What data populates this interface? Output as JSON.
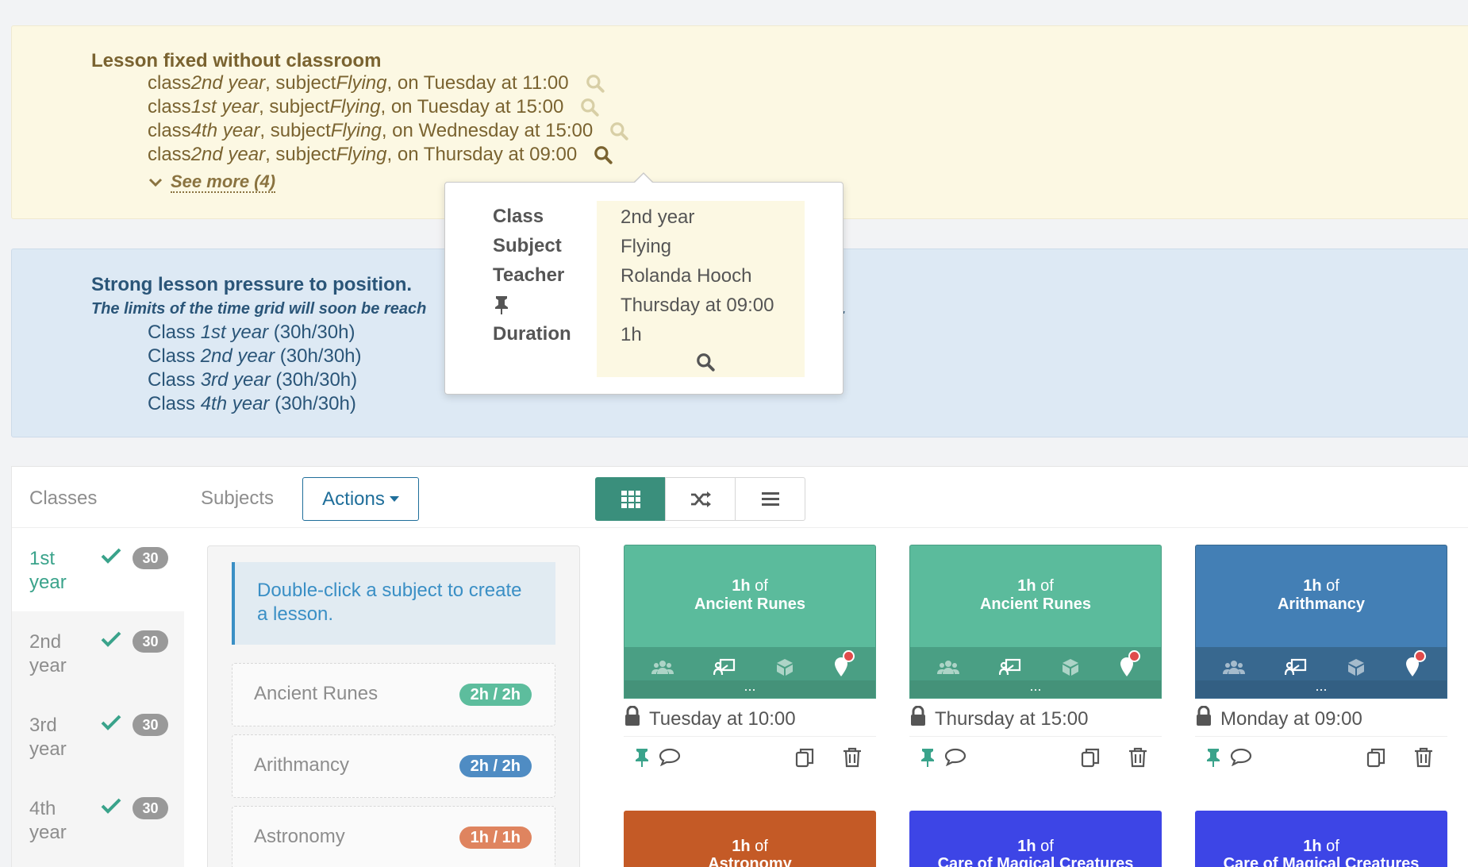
{
  "warning": {
    "title": "Lesson fixed without classroom",
    "lines": [
      {
        "pre": "class ",
        "cls": "2nd year",
        "mid": ", subject ",
        "subj": "Flying",
        "post": ", on Tuesday at 11:00"
      },
      {
        "pre": "class ",
        "cls": "1st year",
        "mid": ", subject ",
        "subj": "Flying",
        "post": ", on Tuesday at 15:00"
      },
      {
        "pre": "class ",
        "cls": "4th year",
        "mid": ", subject ",
        "subj": "Flying",
        "post": ", on Wednesday at 15:00"
      },
      {
        "pre": "class ",
        "cls": "2nd year",
        "mid": ", subject ",
        "subj": "Flying",
        "post": ", on Thursday at 09:00"
      }
    ],
    "see_more": "See more (4)"
  },
  "info": {
    "title": "Strong lesson pressure to position.",
    "subtitle_left": "The limits of the time grid will soon be reach",
    "subtitle_right": "y.",
    "lines": [
      {
        "pre": "Class ",
        "cls": "1st year",
        "post": " (30h/30h)"
      },
      {
        "pre": "Class ",
        "cls": "2nd year",
        "post": " (30h/30h)"
      },
      {
        "pre": "Class ",
        "cls": "3rd year",
        "post": " (30h/30h)"
      },
      {
        "pre": "Class ",
        "cls": "4th year",
        "post": " (30h/30h)"
      }
    ]
  },
  "popover": {
    "keys": [
      "Class",
      "Subject",
      "Teacher",
      "",
      "Duration"
    ],
    "values": [
      "2nd year",
      "Flying",
      "Rolanda Hooch",
      "Thursday at 09:00",
      "1h"
    ]
  },
  "panel": {
    "tab_classes": "Classes",
    "tab_subjects": "Subjects",
    "actions_label": "Actions",
    "classes": [
      {
        "label": "1st year",
        "count": "30"
      },
      {
        "label": "2nd year",
        "count": "30"
      },
      {
        "label": "3rd year",
        "count": "30"
      },
      {
        "label": "4th year",
        "count": "30"
      }
    ],
    "hint": "Double-click a subject to create a lesson.",
    "subjects": [
      {
        "name": "Ancient Runes",
        "count": "2h / 2h",
        "color": "#5dbd9d"
      },
      {
        "name": "Arithmancy",
        "count": "2h / 2h",
        "color": "#4f8cc3"
      },
      {
        "name": "Astronomy",
        "count": "1h / 1h",
        "color": "#df845f"
      }
    ],
    "cards": [
      {
        "dur": "1h",
        "of": " of",
        "subject": "Ancient Runes",
        "time": "Tuesday at 10:00",
        "color": "#5bbb9c",
        "mid": "#4a9f84"
      },
      {
        "dur": "1h",
        "of": " of",
        "subject": "Ancient Runes",
        "time": "Thursday at 15:00",
        "color": "#5bbb9c",
        "mid": "#4a9f84"
      },
      {
        "dur": "1h",
        "of": " of",
        "subject": "Arithmancy",
        "time": "Monday at 09:00",
        "color": "#437fb5",
        "mid": "#38688f"
      }
    ],
    "cards_row2": [
      {
        "dur": "1h",
        "of": " of",
        "subject": "Astronomy",
        "color": "#c45a26"
      },
      {
        "dur": "1h",
        "of": " of",
        "subject": "Care of Magical Creatures",
        "color": "#3d45e6"
      },
      {
        "dur": "1h",
        "of": " of",
        "subject": "Care of Magical Creatures",
        "color": "#3d45e6"
      }
    ],
    "card_more": "..."
  }
}
